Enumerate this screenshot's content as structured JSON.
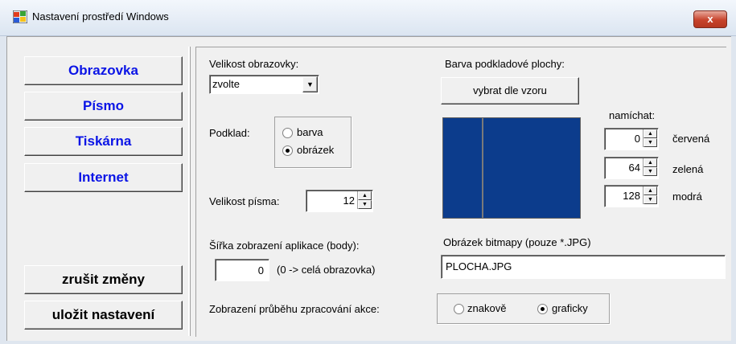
{
  "window": {
    "title": "Nastavení prostředí Windows",
    "close_label": "x"
  },
  "nav": {
    "obrazovka": "Obrazovka",
    "pismo": "Písmo",
    "tiskarna": "Tiskárna",
    "internet": "Internet",
    "cancel": "zrušit změny",
    "save": "uložit nastavení"
  },
  "screen_size": {
    "label": "Velikost obrazovky:",
    "value": "zvolte"
  },
  "background": {
    "label": "Podklad:",
    "option_color": "barva",
    "option_image": "obrázek",
    "selected": "obrázek"
  },
  "font_size": {
    "label": "Velikost písma:",
    "value": "12"
  },
  "app_width": {
    "label": "Šířka zobrazení aplikace (body):",
    "value": "0",
    "hint": "(0 -> celá obrazovka)"
  },
  "bg_color": {
    "label": "Barva podkladové plochy:",
    "pick_button": "vybrat dle vzoru",
    "mix_label": "namíchat:",
    "preview_color": "#0c3c8c",
    "red_value": "0",
    "red_label": "červená",
    "green_value": "64",
    "green_label": "zelená",
    "blue_value": "128",
    "blue_label": "modrá"
  },
  "bitmap": {
    "label": "Obrázek bitmapy (pouze *.JPG)",
    "value": "PLOCHA.JPG"
  },
  "progress_display": {
    "label": "Zobrazení průběhu zpracování akce:",
    "option_char": "znakově",
    "option_graphic": "graficky",
    "selected": "graficky"
  }
}
